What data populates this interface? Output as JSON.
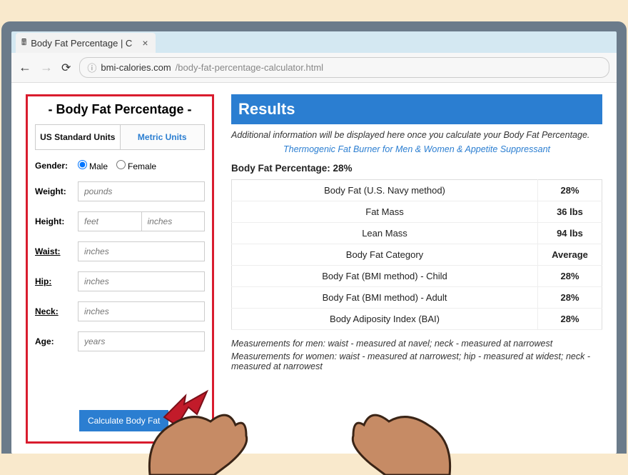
{
  "browser": {
    "tab_title": "Body Fat Percentage | C",
    "url_domain": "bmi-calories.com",
    "url_path": "/body-fat-percentage-calculator.html"
  },
  "calculator": {
    "title": "- Body Fat Percentage -",
    "tab_us": "US Standard Units",
    "tab_metric": "Metric Units",
    "labels": {
      "gender": "Gender:",
      "male": "Male",
      "female": "Female",
      "weight": "Weight:",
      "height": "Height:",
      "waist": "Waist:",
      "hip": "Hip:",
      "neck": "Neck:",
      "age": "Age:"
    },
    "placeholders": {
      "weight": "pounds",
      "feet": "feet",
      "inches": "inches",
      "waist": "inches",
      "hip": "inches",
      "neck": "inches",
      "age": "years"
    },
    "button": "Calculate Body Fat"
  },
  "results": {
    "header": "Results",
    "info": "Additional information will be displayed here once you calculate your Body Fat Percentage.",
    "promo_link": "Thermogenic Fat Burner for Men & Women & Appetite Suppressant",
    "summary": "Body Fat Percentage: 28%",
    "rows": [
      {
        "label": "Body Fat (U.S. Navy method)",
        "value": "28%"
      },
      {
        "label": "Fat Mass",
        "value": "36 lbs"
      },
      {
        "label": "Lean Mass",
        "value": "94 lbs"
      },
      {
        "label": "Body Fat Category",
        "value": "Average"
      },
      {
        "label": "Body Fat (BMI method) - Child",
        "value": "28%"
      },
      {
        "label": "Body Fat (BMI method) - Adult",
        "value": "28%"
      },
      {
        "label": "Body Adiposity Index (BAI)",
        "value": "28%"
      }
    ],
    "note_men": "Measurements for men: waist - measured at navel; neck - measured at narrowest",
    "note_women": "Measurements for women: waist - measured at narrowest; hip - measured at widest; neck - measured at narrowest"
  }
}
